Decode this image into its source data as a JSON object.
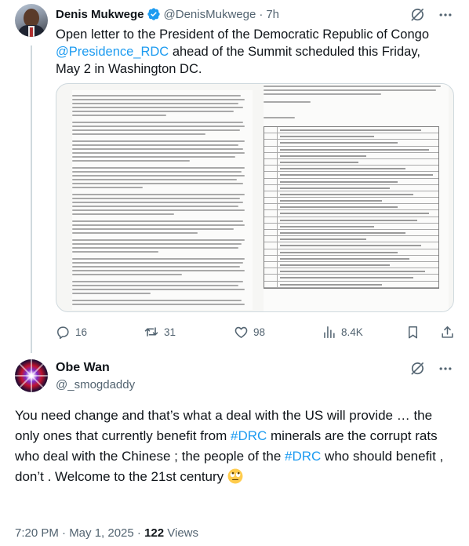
{
  "parent_tweet": {
    "display_name": "Denis Mukwege",
    "handle": "@DenisMukwege",
    "separator": "·",
    "time": "7h",
    "text": {
      "line1": "Open letter to the President of the Democratic Republic of Congo",
      "mention": "@Presidence_RDC",
      "line2_rest": " ahead of the Summit scheduled this Friday,",
      "line3": "May 2 in Washington DC."
    },
    "metrics": {
      "replies": "16",
      "reposts": "31",
      "likes": "98",
      "views": "8.4K"
    },
    "verified_color": "#1d9bf0"
  },
  "reply_tweet": {
    "display_name": "Obe Wan",
    "handle": "@_smogdaddy",
    "text": {
      "part1": "You need change and that’s what a deal with the US will provide … the only ones that currently benefit from ",
      "hashtag1": "#DRC",
      "part2": " minerals are the corrupt rats who deal with the Chinese ; the people of the ",
      "hashtag2": "#DRC",
      "part3": " who should benefit , don’t . Welcome to the 21st century "
    },
    "emoji": "face-with-rolling-eyes",
    "timestamp": "7:20 PM · May 1, 2025 · ",
    "views_count": "122",
    "views_label": " Views"
  },
  "colors": {
    "link": "#1d9bf0",
    "secondary_text": "#536471",
    "primary_text": "#0f1419"
  }
}
